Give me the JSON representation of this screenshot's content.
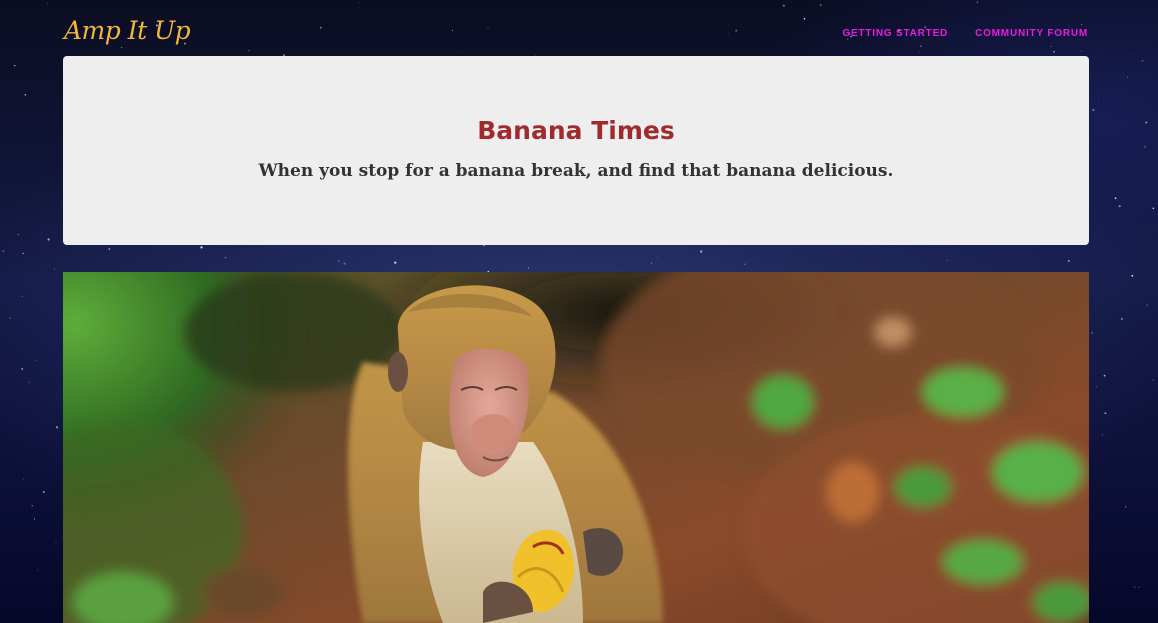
{
  "site": {
    "brand": "Amp It Up"
  },
  "nav": {
    "links": [
      {
        "label": "Getting Started"
      },
      {
        "label": "Community Forum"
      }
    ]
  },
  "hero": {
    "title": "Banana Times",
    "subtitle": "When you stop for a banana break, and find that banana delicious."
  },
  "image": {
    "subject": "monkey eating a banana"
  },
  "colors": {
    "brand": "#f2b63a",
    "nav_link": "#e81ce0",
    "title": "#a02a2e",
    "subtitle": "#333333",
    "card_background": "#eeeeee"
  }
}
